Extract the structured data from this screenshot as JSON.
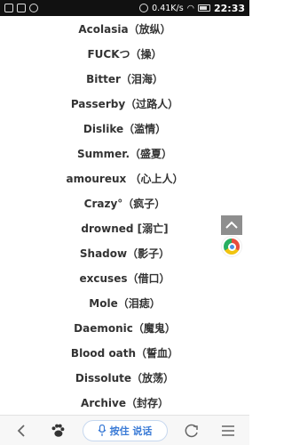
{
  "status_bar": {
    "speed": "0.41K/s",
    "time": "22:33"
  },
  "list": {
    "items": [
      "Acolasia（放纵）",
      "FUCKつ（操）",
      "Bitter（泪海）",
      "Passerby（过路人）",
      "Dislike（滥情）",
      "Summer.（盛夏）",
      "amoureux （心上人）",
      "Crazy°（疯子）",
      "drowned [溺亡]",
      "Shadow（影子）",
      "excuses（借口）",
      "Mole（泪痣）",
      "Daemonic（魔鬼）",
      "Blood oath（誓血）",
      "Dissolute（放荡）",
      "Archive（封存）"
    ]
  },
  "bottom_bar": {
    "voice_label": "按住 说话"
  },
  "icons": {
    "back": "back-arrow-icon",
    "paw": "paw-icon",
    "mic": "microphone-icon",
    "refresh": "refresh-icon",
    "menu": "menu-icon",
    "scroll_top": "chevron-up-icon",
    "browser_badge": "chrome-icon"
  },
  "colors": {
    "text": "#333333",
    "voice_accent": "#3b7bd6",
    "scroll_top_bg": "#8e8e8e",
    "status_bar_bg": "#111111"
  }
}
